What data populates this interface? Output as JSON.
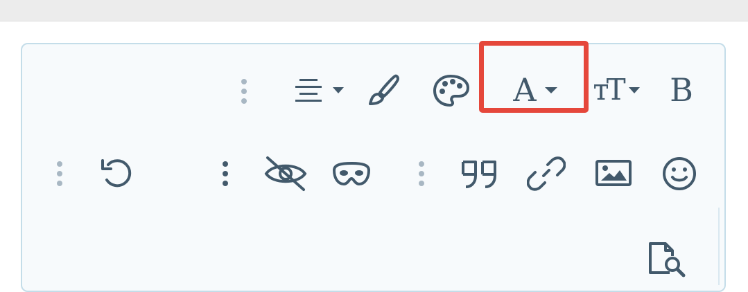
{
  "toolbar": {
    "text_color_letter": "A",
    "bold_letter": "B",
    "font_size_letters": "тT"
  },
  "icons": {
    "align": "align-center-icon",
    "brush": "paintbrush-icon",
    "palette": "palette-icon",
    "text_color": "text-color-icon",
    "font_size": "font-size-icon",
    "bold": "bold-icon",
    "undo": "undo-icon",
    "more": "more-vertical-icon",
    "hide": "eye-slash-icon",
    "spoiler": "mask-icon",
    "quote": "quote-icon",
    "link": "link-icon",
    "image": "image-icon",
    "emoji": "smiley-icon",
    "preview": "file-search-icon"
  },
  "colors": {
    "icon": "#42596b",
    "highlight": "#e5473b",
    "editor_border": "#c4dde9",
    "editor_bg": "#f7fafc"
  }
}
